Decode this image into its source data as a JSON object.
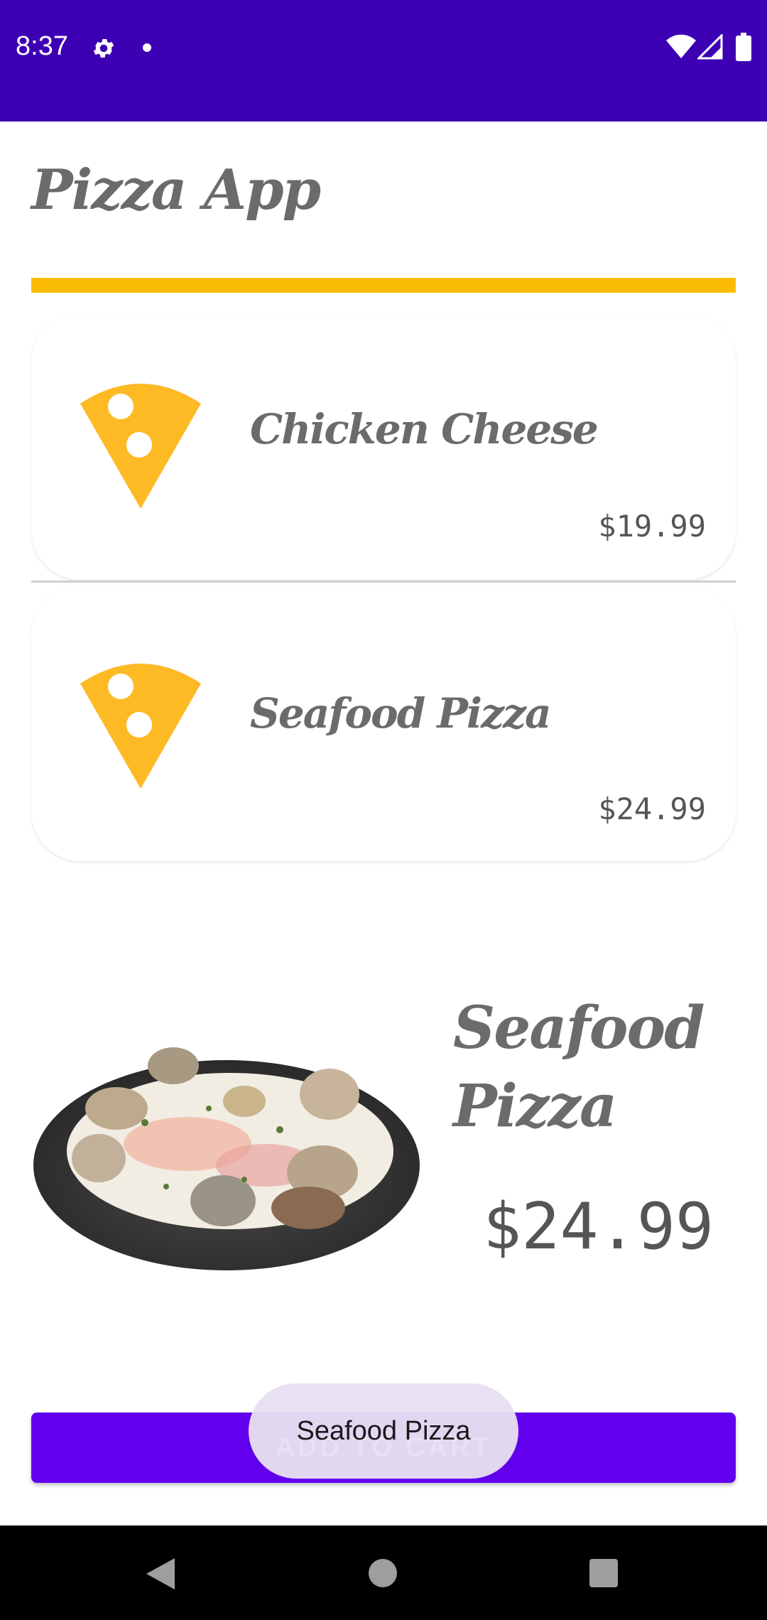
{
  "status_bar": {
    "time": "8:37",
    "background_color": "#3E00B3",
    "icons": [
      "gear-icon",
      "notification-dot-icon",
      "wifi-icon",
      "signal-icon",
      "battery-icon"
    ]
  },
  "header": {
    "title": "Pizza App",
    "accent_color": "#FBBC04"
  },
  "pizza_list": [
    {
      "name": "Chicken Cheese",
      "price": "$19.99",
      "icon": "pizza-slice-icon"
    },
    {
      "name": "Seafood Pizza",
      "price": "$24.99",
      "icon": "pizza-slice-icon"
    }
  ],
  "detail": {
    "name": "Seafood Pizza",
    "price": "$24.99",
    "image": "seafood-pizza-image"
  },
  "add_to_cart": {
    "label": "ADD TO CART",
    "color": "#6200EE"
  },
  "toast": {
    "message": "Seafood Pizza"
  },
  "nav_bar": {
    "icons": [
      "back-icon",
      "home-icon",
      "recents-icon"
    ]
  }
}
